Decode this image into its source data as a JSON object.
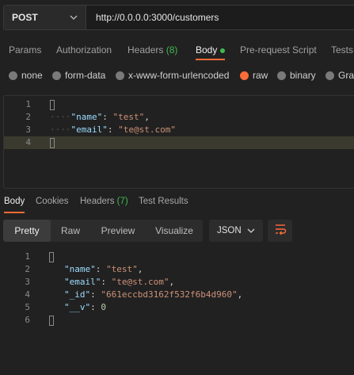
{
  "request": {
    "method": "POST",
    "url": "http://0.0.0.0:3000/customers"
  },
  "request_tabs": {
    "params": "Params",
    "authorization": "Authorization",
    "headers": "Headers",
    "headers_count": "(8)",
    "body": "Body",
    "pre_request": "Pre-request Script",
    "tests": "Tests"
  },
  "body_types": {
    "none": "none",
    "form_data": "form-data",
    "urlencoded": "x-www-form-urlencoded",
    "raw": "raw",
    "binary": "binary",
    "graphql": "Grap",
    "selected": "raw"
  },
  "request_body": {
    "line_numbers": [
      "1",
      "2",
      "3",
      "4"
    ],
    "name_key": "\"name\"",
    "name_value": "\"test\"",
    "email_key": "\"email\"",
    "email_value": "\"te@st.com\""
  },
  "response_tabs": {
    "body": "Body",
    "cookies": "Cookies",
    "headers": "Headers",
    "headers_count": "(7)",
    "test_results": "Test Results"
  },
  "view_modes": {
    "pretty": "Pretty",
    "raw": "Raw",
    "preview": "Preview",
    "visualize": "Visualize",
    "active": "Pretty"
  },
  "format": {
    "selected": "JSON"
  },
  "response_body": {
    "line_numbers": [
      "1",
      "2",
      "3",
      "4",
      "5",
      "6"
    ],
    "name_key": "\"name\"",
    "name_value": "\"test\"",
    "email_key": "\"email\"",
    "email_value": "\"te@st.com\"",
    "id_key": "\"_id\"",
    "id_value": "\"661eccbd3162f532f6b4d960\"",
    "v_key": "\"__v\"",
    "v_value": "0"
  },
  "colors": {
    "accent": "#ff6c37",
    "success": "#3fb950",
    "background": "#212121"
  },
  "icons": {
    "method_dropdown": "chevron-down-icon",
    "format_dropdown": "chevron-down-icon",
    "wrap": "wrap-lines-icon"
  }
}
